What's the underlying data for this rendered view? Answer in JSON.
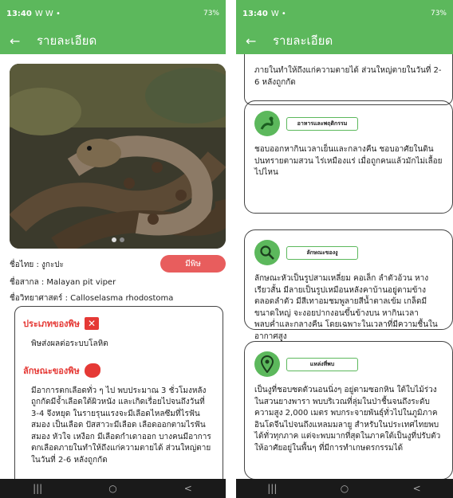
{
  "left": {
    "status": {
      "time": "13:40",
      "icons": "W W •",
      "right": "73%"
    },
    "appbar": {
      "title": "รายละเอียด"
    },
    "info": {
      "thai_name": "ชื่อไทย : งูกะปะ",
      "common_name": "ชื่อสากล : Malayan pit viper",
      "sci_name": "ชื่อวิทยาศาสตร์ : Calloselasma rhodostoma",
      "venom_badge": "มีพิษ"
    },
    "venom_type": {
      "title": "ประเภทของพิษ",
      "text": "พิษส่งผลต่อระบบโลหิต"
    },
    "symptoms": {
      "title": "ลักษณะของพิษ",
      "text": "มีอาการตกเลือดทั่ว ๆ ไป พบประมาณ 3 ชั่วโมงหลังถูกกัดมีจ้ำเลือดใต้ผิวหนัง และเกิดเรื่อยไปจนถึงวันที่ 3-4 จึงหยุด ในรายรุนแรงจะมีเลือดไหลซึมที่ไรฟัน สมอง เป็นเลือด ปัสสาวะมีเลือด เลือดออกตามไรฟัน สมอง หัวใจ เหงือก มีเลือดกำเดาออก บางคนมีอาการตกเลือดภายในทำให้ถึงแก่ความตายได้ ส่วนใหญ่ตายในวันที่ 2-6 หลังถูกกัด"
    }
  },
  "right": {
    "status": {
      "time": "13:40",
      "icons": "W •",
      "right": "73%"
    },
    "appbar": {
      "title": "รายละเอียด"
    },
    "top_text": "ภายในทำให้ถึงแก่ความตายได้ ส่วนใหญ่ตายในวันที่ 2-6 หลังถูกกัด",
    "food": {
      "label": "อาหารและพฤติกรรม",
      "text": "ชอบออกหากินเวลาเย็นและกลางคืน ชอบอาศัยในดินปนทรายตามสวน ไร่เหมืองแร่ เมื่อถูกคนแล้วมักไม่เลื้อยไปไหน"
    },
    "appearance": {
      "label": "ลักษณะของงู",
      "text": "ลักษณะหัวเป็นรูปสามเหลี่ยม คอเล็ก ลำตัวอ้วน หางเรียวสั้น มีลายเป็นรูปเหมือนหลังคาบ้านอยู่ตามข้างตลอดลำตัว มีสีเทาอมชมพูลายสีน้ำตาลเข้ม เกล็ดมีขนาดใหญ่ จะงอยปากงอนขึ้นข้างบน หากินเวลาพลบค่ำและกลางคืน โดยเฉพาะในเวลาที่มีความชื้นในอากาศสูง"
    },
    "habitat": {
      "label": "แหล่งที่พบ",
      "text": "เป็นงูที่ชอบซดตัวนอนนิ่งๆ อยู่ตามซอกหิน ใต้ใบไม้ร่วงในสวนยางพารา พบบริเวณที่ลุ่มในป่าชื้นจนถึงระดับความสูง 2,000 เมตร พบกระจายพันธุ์ทั่วไปในภูมิภาคอินโดจีนไปจนถึงแหลมมลายู สำหรับในประเทศไทยพบได้ทั่วทุกภาค แต่จะพบมากที่สุดในภาคใต้เป็นงูที่ปรับตัวให้อาศัยอยู่ในพื้นๆ ที่มีการทำเกษตรกรรมได้"
    }
  },
  "nav": {
    "recent": "|||",
    "home": "○",
    "back": "<"
  }
}
